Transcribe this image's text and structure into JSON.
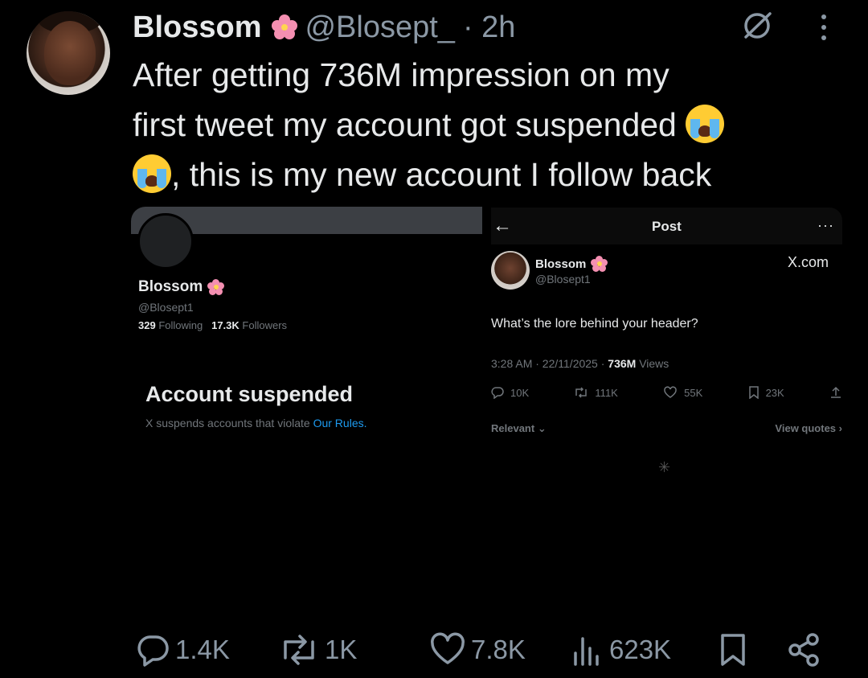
{
  "tweet": {
    "display_name": "Blossom",
    "handle": "@Blosept_",
    "time": "· 2h",
    "text_line1": "After getting 736M impression on my",
    "text_line2a": "first tweet my account got suspended ",
    "text_line3": ", this is my new account I follow back",
    "emojis": [
      "loudly-crying-face",
      "loudly-crying-face"
    ],
    "name_emoji": "cherry-blossom",
    "actions": {
      "replies": "1.4K",
      "reposts": "1K",
      "likes": "7.8K",
      "views": "623K"
    }
  },
  "left_image": {
    "name": "Blossom",
    "handle": "@Blosept1",
    "following_count": "329",
    "following_label": "Following",
    "followers_count": "17.3K",
    "followers_label": "Followers",
    "suspended_title": "Account suspended",
    "suspended_text": "X suspends accounts that violate ",
    "rules_link": "Our Rules."
  },
  "right_image": {
    "back_arrow": "←",
    "title": "Post",
    "menu": "···",
    "name": "Blossom",
    "handle": "@Blosept1",
    "watermark": "X.com",
    "text": "What’s the lore behind your header?",
    "meta_time": "3:28 AM · 22/11/2025 · ",
    "meta_views_count": "736M",
    "meta_views_label": " Views",
    "actions": {
      "replies": "10K",
      "reposts": "111K",
      "likes": "55K",
      "bookmarks": "23K"
    },
    "relevant": "Relevant",
    "view_quotes": "View quotes"
  },
  "colors": {
    "background": "#000000",
    "text_primary": "#e7e9ea",
    "text_secondary": "#8b98a5",
    "link": "#1d9bf0"
  }
}
